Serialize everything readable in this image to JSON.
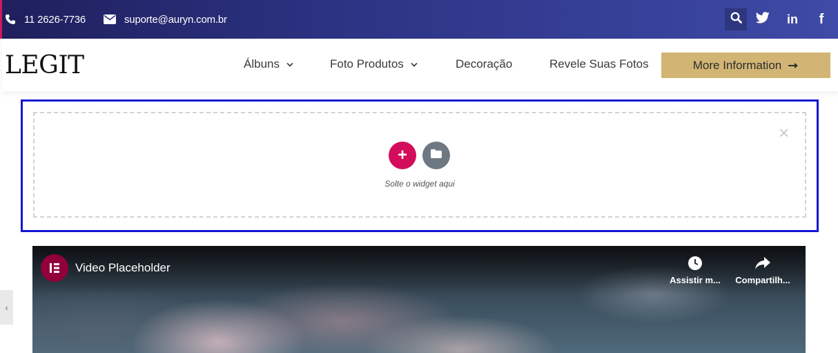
{
  "topbar": {
    "phone": "11 2626-7736",
    "email": "suporte@auryn.com.br",
    "icons": [
      "phone-icon",
      "envelope-icon",
      "search-icon",
      "twitter-icon",
      "linkedin-icon",
      "facebook-icon"
    ],
    "linkedin_glyph": "in",
    "facebook_glyph": "f"
  },
  "header": {
    "logo": "LEGIT",
    "nav": [
      {
        "label": "Álbuns",
        "dropdown": true
      },
      {
        "label": "Foto Produtos",
        "dropdown": true
      },
      {
        "label": "Decoração",
        "dropdown": false
      },
      {
        "label": "Revele Suas Fotos",
        "dropdown": false
      }
    ],
    "cta_label": "More Information"
  },
  "dropzone": {
    "text": "Solte o widget aqui",
    "add_glyph": "+",
    "close_glyph": "×"
  },
  "video": {
    "title": "Video Placeholder",
    "watch_label": "Assistir m...",
    "share_label": "Compartilh..."
  },
  "sidetab": {
    "glyph": "‹"
  },
  "colors": {
    "topbar_start": "#1f1f5c",
    "topbar_end": "#3e4aa7",
    "cta": "#d2b574",
    "selection_border": "#1414d2",
    "add_button": "#d30c5c",
    "folder_button": "#6d7882",
    "elementor_logo": "#92003b"
  }
}
